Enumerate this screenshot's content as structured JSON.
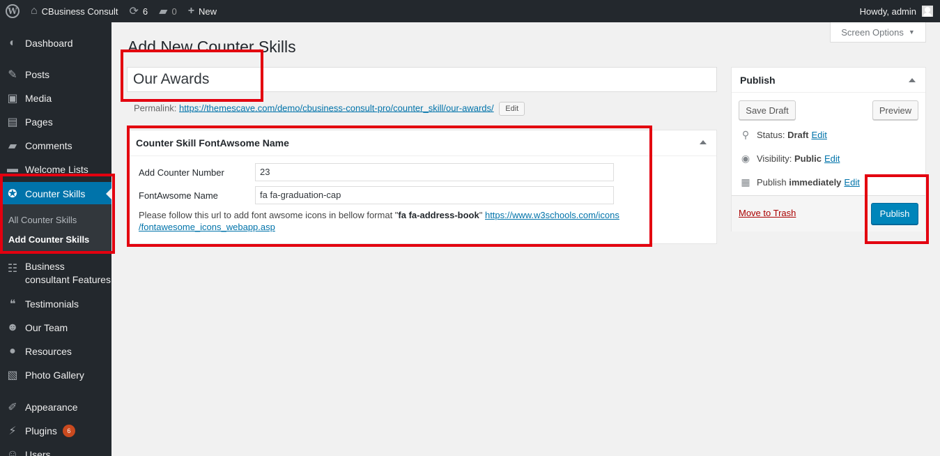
{
  "adminbar": {
    "site_name": "CBusiness Consult",
    "updates_count": "6",
    "comments_count": "0",
    "new_label": "New",
    "howdy": "Howdy, admin"
  },
  "sidebar": {
    "items": [
      {
        "label": "Dashboard",
        "icon": "dashboard-icon"
      },
      {
        "label": "Posts",
        "icon": "pin-icon"
      },
      {
        "label": "Media",
        "icon": "media-icon"
      },
      {
        "label": "Pages",
        "icon": "pages-icon"
      },
      {
        "label": "Comments",
        "icon": "comment-icon"
      },
      {
        "label": "Welcome Lists",
        "icon": "heart-icon"
      },
      {
        "label": "Counter Skills",
        "icon": "counter-icon"
      },
      {
        "label": "Business consultant Features",
        "icon": "sitemap-icon"
      },
      {
        "label": "Testimonials",
        "icon": "quote-icon"
      },
      {
        "label": "Our Team",
        "icon": "groups-icon"
      },
      {
        "label": "Resources",
        "icon": "users-icon"
      },
      {
        "label": "Photo Gallery",
        "icon": "gallery-icon"
      },
      {
        "label": "Appearance",
        "icon": "brush-icon"
      },
      {
        "label": "Plugins",
        "icon": "plug-icon",
        "badge": "6"
      },
      {
        "label": "Users",
        "icon": "user-icon"
      }
    ],
    "submenu": {
      "all": "All Counter Skills",
      "add": "Add Counter Skills"
    }
  },
  "screen_options": "Screen Options",
  "page_title": "Add New Counter Skills",
  "post_title_value": "Our Awards",
  "permalink": {
    "label": "Permalink:",
    "url_base": "https://themescave.com/demo/cbusiness-consult-pro/counter_skill/",
    "slug": "our-awards",
    "trail": "/",
    "edit": "Edit"
  },
  "metabox": {
    "title": "Counter Skill FontAwsome Name",
    "counter_label": "Add Counter Number",
    "counter_value": "23",
    "fa_label": "FontAwsome Name",
    "fa_value": "fa fa-graduation-cap",
    "note_prefix": "Please follow this url to add font awsome icons in bellow format \"",
    "note_example": "fa fa-address-book",
    "note_suffix": "\"",
    "note_link_1": "https://www.w3schools.com/icons",
    "note_link_2": "/fontawesome_icons_webapp.asp"
  },
  "publish_box": {
    "title": "Publish",
    "save_draft": "Save Draft",
    "preview": "Preview",
    "status_label": "Status:",
    "status_value": "Draft",
    "visibility_label": "Visibility:",
    "visibility_value": "Public",
    "publish_label": "Publish",
    "publish_value": "immediately",
    "edit": "Edit",
    "trash": "Move to Trash",
    "publish_button": "Publish"
  },
  "colors": {
    "admin_bar": "#23282d",
    "accent": "#0073aa",
    "publish_button": "#0085ba",
    "highlight_box": "#e3000f"
  }
}
